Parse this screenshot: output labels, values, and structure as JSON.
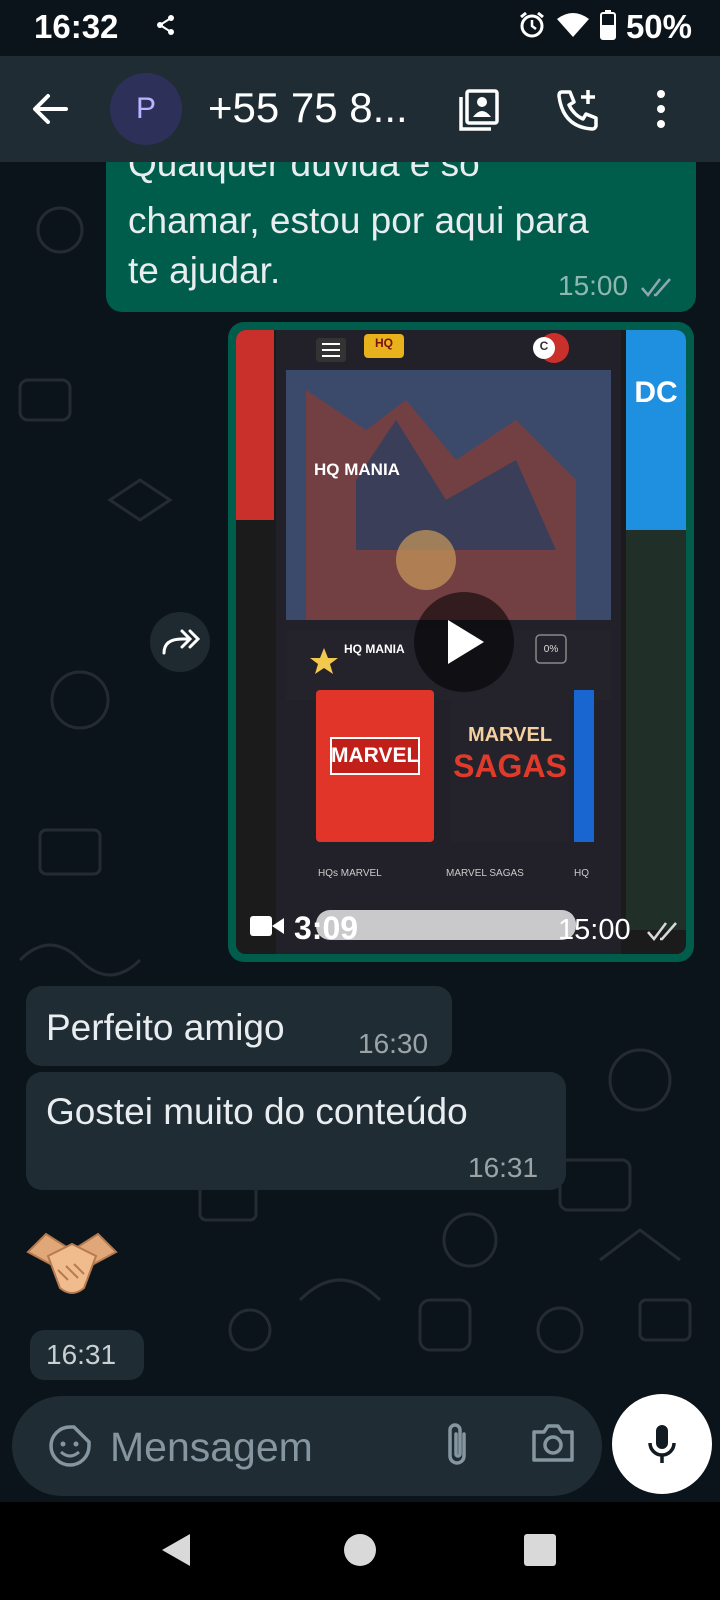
{
  "status_bar": {
    "time": "16:32",
    "battery": "50%",
    "icons": [
      "share-icon",
      "alarm-icon",
      "wifi-icon",
      "battery-icon"
    ]
  },
  "header": {
    "avatar_letter": "P",
    "contact_name": "+55 75 8...",
    "icons": [
      "back-arrow-icon",
      "contact-card-icon",
      "add-call-icon",
      "more-vert-icon"
    ]
  },
  "messages": [
    {
      "direction": "outgoing",
      "text_lines": [
        "Qualquer dúvida é só",
        "chamar, estou por aqui para",
        "te ajudar."
      ],
      "time": "15:00",
      "status": "read"
    },
    {
      "direction": "outgoing",
      "type": "video",
      "duration": "3:09",
      "time": "15:00",
      "status": "read",
      "thumbnail_text": {
        "title": "HQ MANIA",
        "row_label": "HQ MANIA",
        "percent": "0%",
        "logo": "HQ",
        "avatar": "C",
        "cards": [
          {
            "brand": "MARVEL",
            "caption": "HQs MARVEL"
          },
          {
            "brand_line1": "MARVEL",
            "brand_line2": "SAGAS",
            "caption": "MARVEL SAGAS"
          },
          {
            "caption": "HQ"
          }
        ],
        "side_logo": "DC"
      }
    },
    {
      "direction": "incoming",
      "text": "Perfeito amigo",
      "time": "16:30"
    },
    {
      "direction": "incoming",
      "text": "Gostei muito do conteúdo",
      "time": "16:31"
    },
    {
      "direction": "incoming",
      "type": "emoji",
      "text": "🤝🏼",
      "time": "16:31"
    }
  ],
  "composer": {
    "placeholder": "Mensagem",
    "icons": [
      "sticker-icon",
      "attach-icon",
      "camera-icon",
      "mic-icon"
    ]
  },
  "nav_bar": {
    "icons": [
      "nav-back-icon",
      "nav-home-icon",
      "nav-recents-icon"
    ]
  },
  "colors": {
    "background": "#0b141a",
    "header": "#1f2c34",
    "outgoing_bubble": "#005c4b",
    "incoming_bubble": "#1f2c34",
    "text": "#e9edef"
  }
}
